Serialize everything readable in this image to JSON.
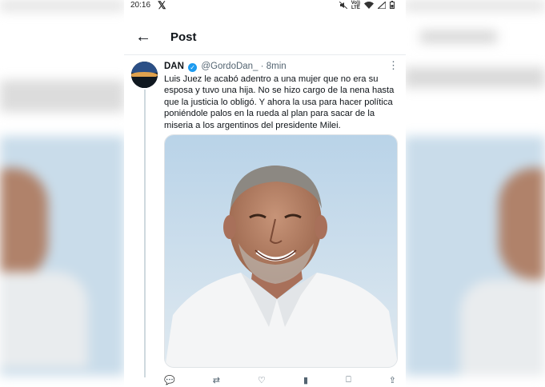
{
  "status_bar": {
    "time": "20:16",
    "app_logo": "𝕏",
    "network_top": "Vo))",
    "network_bottom": "LTE",
    "icons": [
      "mute-icon",
      "wifi-icon",
      "signal-icon",
      "battery-icon"
    ]
  },
  "header": {
    "back_icon": "←",
    "title": "Post"
  },
  "tweet": {
    "author_name": "DAN",
    "verified_mark": "✓",
    "handle": "@GordoDan_",
    "separator": "·",
    "time": "8min",
    "more_icon": "⋮",
    "text": "Luis Juez le acabó adentro a una mujer que no era su esposa y tuvo una hija. No se hizo cargo de la nena hasta que la justicia lo obligó. Y ahora la usa para hacer política poniéndole palos en la rueda al plan para sacar de la miseria a los argentinos del presidente Milei."
  },
  "actions": [
    {
      "icon": "reply-icon",
      "glyph": "💬"
    },
    {
      "icon": "repost-icon",
      "glyph": "⇄"
    },
    {
      "icon": "like-icon",
      "glyph": "♡"
    },
    {
      "icon": "views-icon",
      "glyph": "▮"
    },
    {
      "icon": "bookmark-icon",
      "glyph": "⎕"
    },
    {
      "icon": "share-icon",
      "glyph": "⇪"
    }
  ],
  "colors": {
    "accent": "#1d9bf0",
    "secondary_text": "#536471",
    "sky": "#c9dcea"
  }
}
